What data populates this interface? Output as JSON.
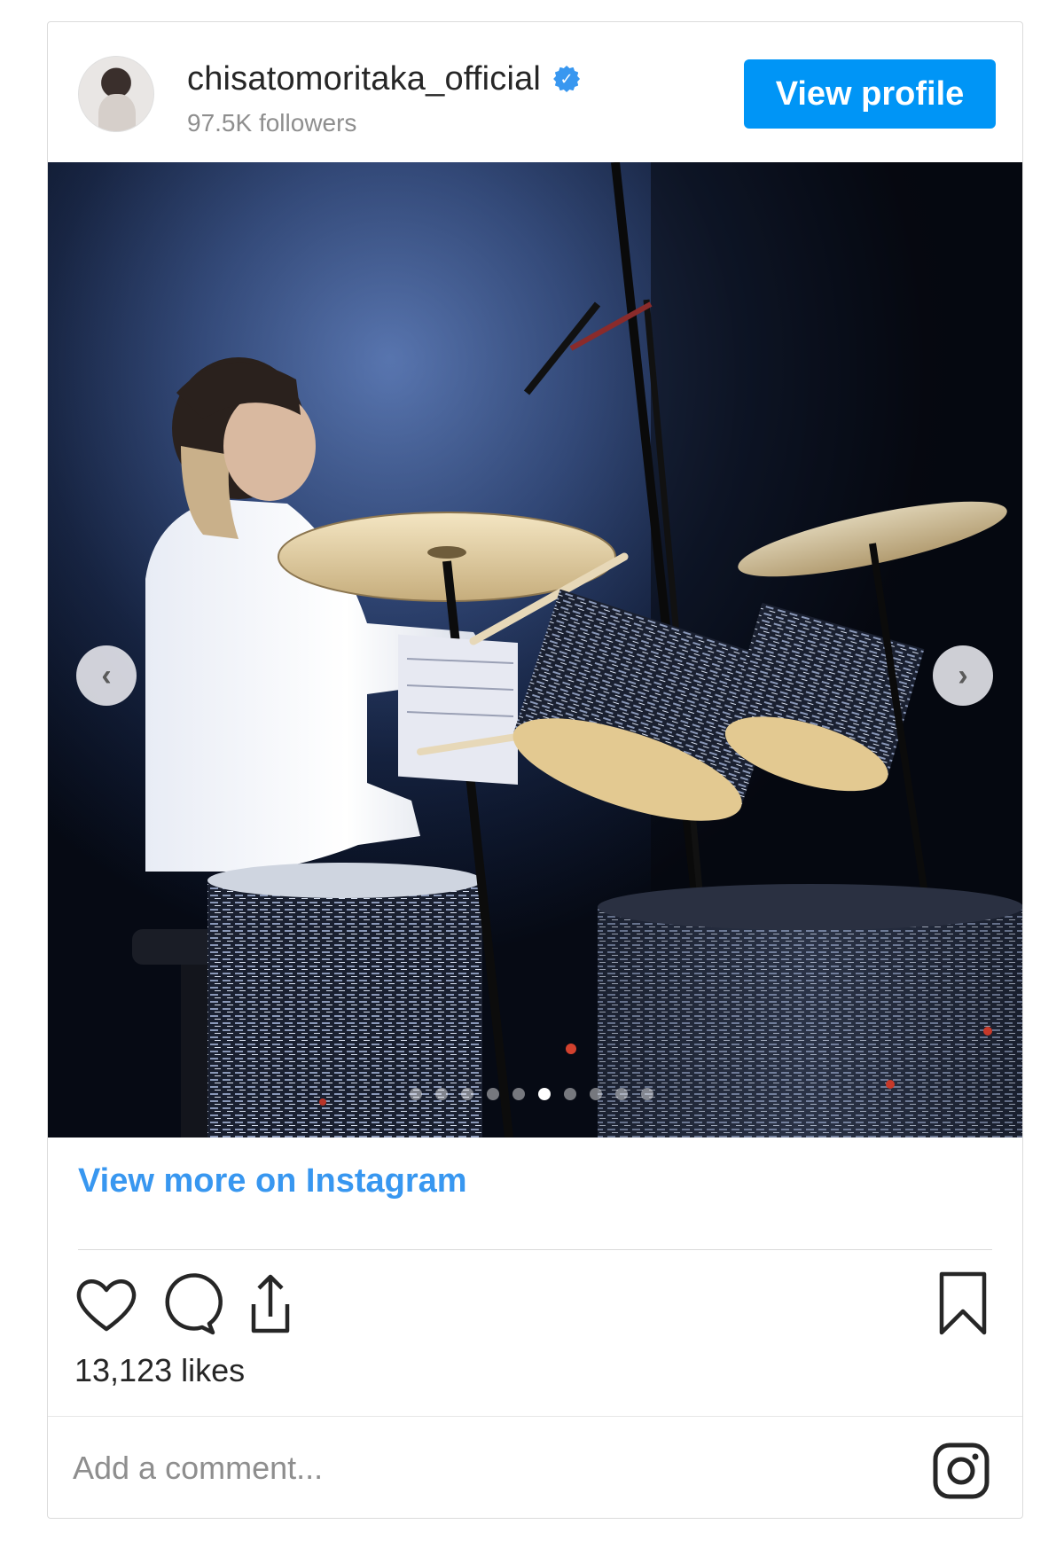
{
  "header": {
    "username": "chisatomoritaka_official",
    "verified": true,
    "followers": "97.5K followers",
    "view_profile_label": "View profile"
  },
  "post": {
    "image_alt": "",
    "carousel": {
      "count": 10,
      "active_index": 5
    }
  },
  "footer": {
    "view_more_label": "View more on Instagram",
    "likes": "13,123 likes",
    "comment_placeholder": "Add a comment..."
  },
  "icons": {
    "verified": "verified-badge-icon",
    "prev": "chevron-left-icon",
    "next": "chevron-right-icon",
    "like": "heart-icon",
    "comment": "comment-bubble-icon",
    "share": "share-upload-icon",
    "save": "bookmark-icon",
    "brand": "instagram-logo-icon"
  },
  "colors": {
    "accent": "#0095f6",
    "link": "#3897f0",
    "text": "#262626",
    "muted": "#8e8e8e"
  }
}
